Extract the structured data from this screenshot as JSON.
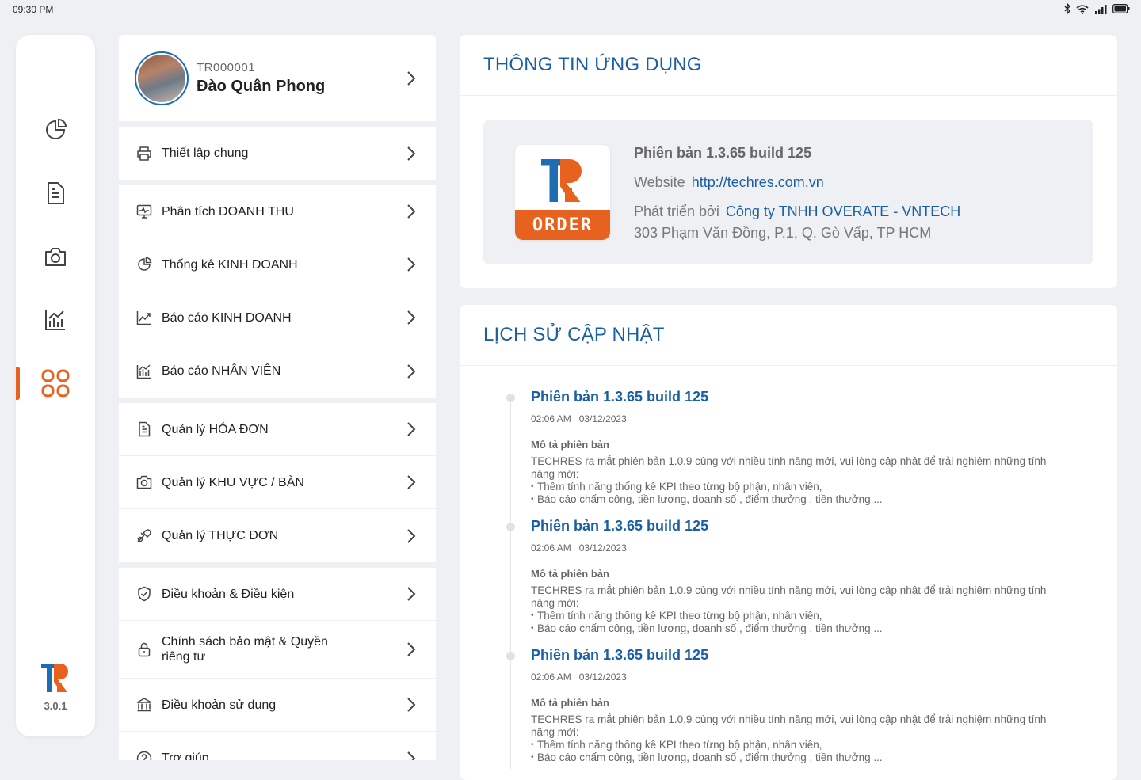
{
  "status_bar": {
    "time": "09:30 PM"
  },
  "rail": {
    "items": [
      {
        "icon": "pie-chart-icon"
      },
      {
        "icon": "document-icon"
      },
      {
        "icon": "camera-icon"
      },
      {
        "icon": "bar-chart-icon"
      },
      {
        "icon": "grid-apps-icon",
        "active": true
      }
    ],
    "version": "3.0.1",
    "accent_color": "#e8621f"
  },
  "profile": {
    "code": "TR000001",
    "name": "Đào Quân Phong"
  },
  "menu": {
    "groups": [
      [
        {
          "icon": "printer-icon",
          "label": "Thiết lập chung"
        }
      ],
      [
        {
          "icon": "monitor-chart-icon",
          "label": "Phân tích DOANH THU"
        },
        {
          "icon": "pie-chart-icon",
          "label": "Thống kê KINH DOANH"
        },
        {
          "icon": "trend-line-icon",
          "label": "Báo cáo KINH DOANH"
        },
        {
          "icon": "bar-chart-icon",
          "label": "Báo cáo NHÂN VIÊN"
        }
      ],
      [
        {
          "icon": "invoice-icon",
          "label": "Quản lý HÓA ĐƠN"
        },
        {
          "icon": "camera-icon",
          "label": "Quản lý KHU VỰC / BÀN"
        },
        {
          "icon": "food-icon",
          "label": "Quản lý THỰC ĐƠN"
        }
      ],
      [
        {
          "icon": "shield-check-icon",
          "label": "Điều khoản & Điều kiện"
        },
        {
          "icon": "lock-icon",
          "label": "Chính sách bảo mật & Quyền riêng tư"
        },
        {
          "icon": "bank-icon",
          "label": "Điều khoản sử dụng"
        },
        {
          "icon": "help-icon",
          "label": "Trợ giúp"
        }
      ]
    ]
  },
  "app_info": {
    "title": "THÔNG TIN ỨNG DỤNG",
    "logo_text": "ORDER",
    "version": "Phiên bản 1.3.65 build 125",
    "website_label": "Website",
    "website_url": "http://techres.com.vn",
    "developer_label": "Phát triển bởi",
    "developer_name": "Công ty TNHH OVERATE - VNTECH",
    "address": "303 Phạm Văn Đồng, P.1, Q. Gò Vấp,  TP HCM"
  },
  "history": {
    "title": "LỊCH SỬ CẬP NHẬT",
    "entries": [
      {
        "title": "Phiên bản 1.3.65 build 125",
        "time": "02:06 AM",
        "date": "03/12/2023",
        "desc_label": "Mô tả phiên bản",
        "desc": "TECHRES ra mắt phiên bản 1.0.9 cùng với nhiều tính năng mới, vui lòng cập nhật để trải nghiệm những tính năng mới:",
        "bullets": [
          "Thêm tính năng thống kê KPI theo từng bộ phận, nhân viên,",
          "Báo cáo chấm công, tiền lương, doanh số , điểm thưởng , tiền thưởng ..."
        ]
      },
      {
        "title": "Phiên bản 1.3.65 build 125",
        "time": "02:06 AM",
        "date": "03/12/2023",
        "desc_label": "Mô tả phiên bản",
        "desc": "TECHRES ra mắt phiên bản 1.0.9 cùng với nhiều tính năng mới, vui lòng cập nhật để trải nghiệm những tính năng mới:",
        "bullets": [
          "Thêm tính năng thống kê KPI theo từng bộ phận, nhân viên,",
          "Báo cáo chấm công, tiền lương, doanh số , điểm thưởng , tiền thưởng ..."
        ]
      },
      {
        "title": "Phiên bản 1.3.65 build 125",
        "time": "02:06 AM",
        "date": "03/12/2023",
        "desc_label": "Mô tả phiên bản",
        "desc": "TECHRES ra mắt phiên bản 1.0.9 cùng với nhiều tính năng mới, vui lòng cập nhật để trải nghiệm những tính năng mới:",
        "bullets": [
          "Thêm tính năng thống kê KPI theo từng bộ phận, nhân viên,",
          "Báo cáo chấm công, tiền lương, doanh số , điểm thưởng , tiền thưởng ..."
        ]
      }
    ]
  },
  "colors": {
    "primary_blue": "#1a5fa3",
    "accent_orange": "#e8621f",
    "background": "#eef0f4"
  }
}
